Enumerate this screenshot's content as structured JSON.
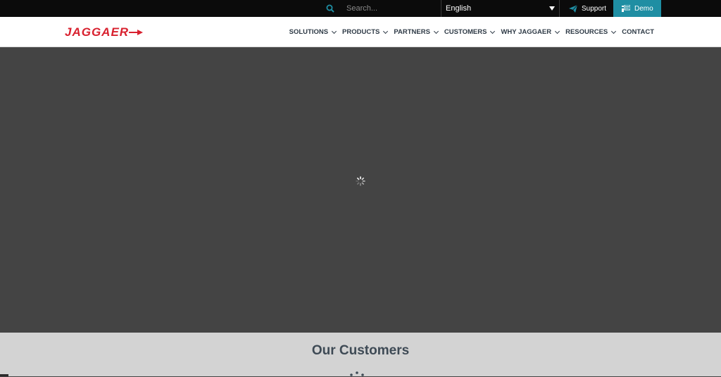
{
  "topbar": {
    "search_placeholder": "Search...",
    "language": "English",
    "support_label": "Support",
    "demo_label": "Demo"
  },
  "header": {
    "logo_text": "JAGGAER",
    "nav": [
      {
        "label": "SOLUTIONS",
        "has_dropdown": true
      },
      {
        "label": "PRODUCTS",
        "has_dropdown": true
      },
      {
        "label": "PARTNERS",
        "has_dropdown": true
      },
      {
        "label": "CUSTOMERS",
        "has_dropdown": true
      },
      {
        "label": "WHY JAGGAER",
        "has_dropdown": true
      },
      {
        "label": "RESOURCES",
        "has_dropdown": true
      },
      {
        "label": "CONTACT",
        "has_dropdown": false
      }
    ]
  },
  "customers": {
    "heading": "Our Customers"
  },
  "colors": {
    "brand_red": "#d8212f",
    "accent_teal": "#1f8ea3",
    "topbar_bg": "#0b0b0b",
    "hero_bg": "#444444",
    "customers_bg": "#d3d3d3"
  },
  "icons": {
    "search": "search-icon",
    "support": "paper-plane-icon",
    "demo": "demo-icon",
    "loading": "spinner-icon"
  }
}
